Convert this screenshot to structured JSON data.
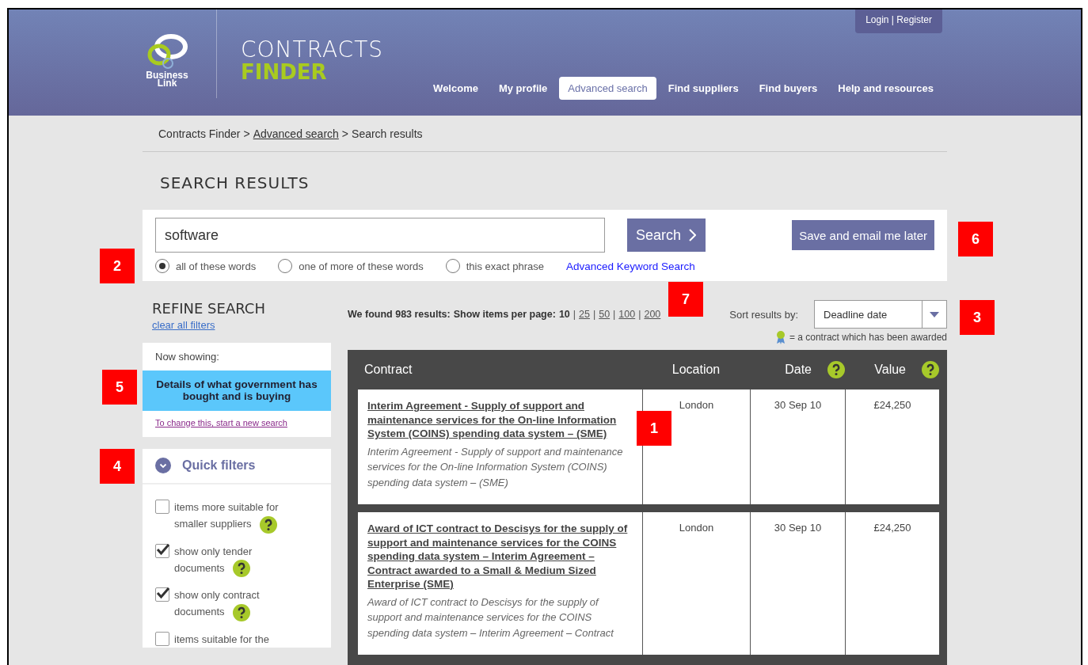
{
  "header": {
    "logo_text": [
      "Business",
      "Link"
    ],
    "site_title": "CONTRACTS",
    "site_subtitle": "FINDER",
    "account_link": "Login | Register",
    "nav": [
      {
        "label": "Welcome",
        "selected": false
      },
      {
        "label": "My profile",
        "selected": false
      },
      {
        "label": "Advanced search",
        "selected": true
      },
      {
        "label": "Find suppliers",
        "selected": false
      },
      {
        "label": "Find buyers",
        "selected": false
      },
      {
        "label": "Help and resources",
        "selected": false
      }
    ]
  },
  "breadcrumb": {
    "separator": ">",
    "items": [
      {
        "label": "Contracts Finder",
        "link": false
      },
      {
        "label": "Advanced search",
        "link": true
      },
      {
        "label": "Search results",
        "link": false
      }
    ]
  },
  "page_title": "SEARCH RESULTS",
  "search": {
    "value": "software",
    "button": "Search",
    "save_button": "Save and email me later",
    "save_marker": "6",
    "marker": "2",
    "options": [
      {
        "label": "all of these words",
        "selected": true
      },
      {
        "label": "one of more of these words",
        "selected": false
      },
      {
        "label": "this exact phrase",
        "selected": false
      }
    ],
    "advanced_link": "Advanced Keyword Search",
    "advanced_marker": "7"
  },
  "refine": {
    "title": "REFINE SEARCH",
    "clear_link": "clear all filters",
    "now_showing": {
      "label": "Now showing:",
      "value": "Details of what government has bought and is buying",
      "change_link": "To change this, start a new search",
      "marker": "5"
    },
    "quick_filters": {
      "title": "Quick filters",
      "expanded": true,
      "marker": "4",
      "filters": [
        {
          "label": "items more suitable for smaller suppliers",
          "checked": false,
          "help": true
        },
        {
          "label": "show only tender documents",
          "checked": true,
          "help": true
        },
        {
          "label": "show only contract documents",
          "checked": true,
          "help": true
        },
        {
          "label": "items suitable for the",
          "checked": false,
          "help": false
        }
      ]
    }
  },
  "results": {
    "count_text": "We found 983 results:",
    "per_page_label": "Show items per page:",
    "page_sizes": [
      {
        "label": "10",
        "selected": true
      },
      {
        "label": "25",
        "selected": false
      },
      {
        "label": "50",
        "selected": false
      },
      {
        "label": "100",
        "selected": false
      },
      {
        "label": "200",
        "selected": false
      }
    ],
    "page_size_separator": "|",
    "sort_label": "Sort results by:",
    "sort_value": "Deadline date",
    "sort_marker": "3",
    "legend": "= a contract which has been awarded",
    "columns": [
      {
        "label": "Contract",
        "help": false
      },
      {
        "label": "Location",
        "help": false
      },
      {
        "label": "Date",
        "help": true
      },
      {
        "label": "Value",
        "help": true
      }
    ],
    "rows": [
      {
        "title": "Interim Agreement - Supply of support and maintenance services for the On-line Information System (COINS) spending data system – (SME)",
        "description": "Interim Agreement - Supply of support and maintenance services for the On-line Information System (COINS) spending data system – (SME)",
        "location": "London",
        "date": "30 Sep 10",
        "value": "£24,250",
        "marker": "1"
      },
      {
        "title": "Award of ICT contract to Descisys for the supply of support and maintenance services for the COINS spending data system – Interim Agreement – Contract awarded to a Small & Medium Sized Enterprise (SME)",
        "description": "Award of ICT contract to Descisys for the supply of support and maintenance services for the COINS spending data system – Interim Agreement – Contract",
        "location": "London",
        "date": "30 Sep 10",
        "value": "£24,250"
      }
    ]
  }
}
